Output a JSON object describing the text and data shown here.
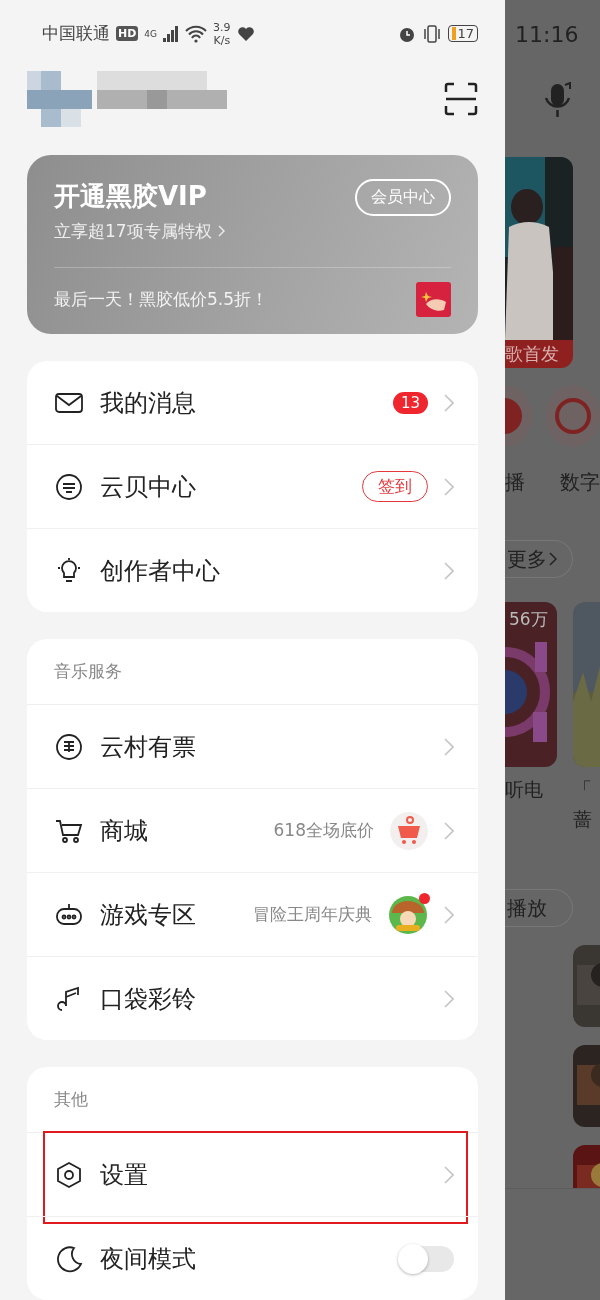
{
  "status_bar": {
    "carrier": "中国联通",
    "network_badge": "HD",
    "network_type": "4G",
    "speed": [
      "3.9",
      "K/s"
    ],
    "battery": "17",
    "time": "11:16"
  },
  "vip_card": {
    "title": "开通黑胶VIP",
    "subtitle": "立享超17项专属特权",
    "button": "会员中心",
    "promo": "最后一天！黑胶低价5.5折！"
  },
  "sections": [
    {
      "items": [
        {
          "label": "我的消息",
          "kind": "badge",
          "badge": "13",
          "highlighted": false
        },
        {
          "label": "云贝中心",
          "kind": "pill",
          "pill": "签到",
          "highlighted": false
        },
        {
          "label": "创作者中心",
          "kind": "chevron",
          "highlighted": false
        }
      ]
    },
    {
      "header": "音乐服务",
      "items": [
        {
          "label": "云村有票",
          "kind": "chevron",
          "highlighted": false
        },
        {
          "label": "商城",
          "kind": "promo",
          "promo": "618全场底价",
          "highlighted": false
        },
        {
          "label": "游戏专区",
          "kind": "promo",
          "promo": "冒险王周年庆典",
          "dot": true,
          "highlighted": false
        },
        {
          "label": "口袋彩铃",
          "kind": "chevron",
          "highlighted": false
        }
      ]
    },
    {
      "header": "其他",
      "items": [
        {
          "label": "设置",
          "kind": "chevron",
          "highlighted": true
        },
        {
          "label": "夜间模式",
          "kind": "toggle",
          "on": false,
          "highlighted": false
        }
      ]
    }
  ],
  "behind_drawer": {
    "banner_label": "歌首发",
    "shortcuts": [
      "播",
      "数字"
    ],
    "more_button": "更多",
    "play_count": "56万",
    "playlist_title": "听电",
    "playlist_title_2": [
      "「",
      "蔷"
    ],
    "play_button": "播放"
  }
}
